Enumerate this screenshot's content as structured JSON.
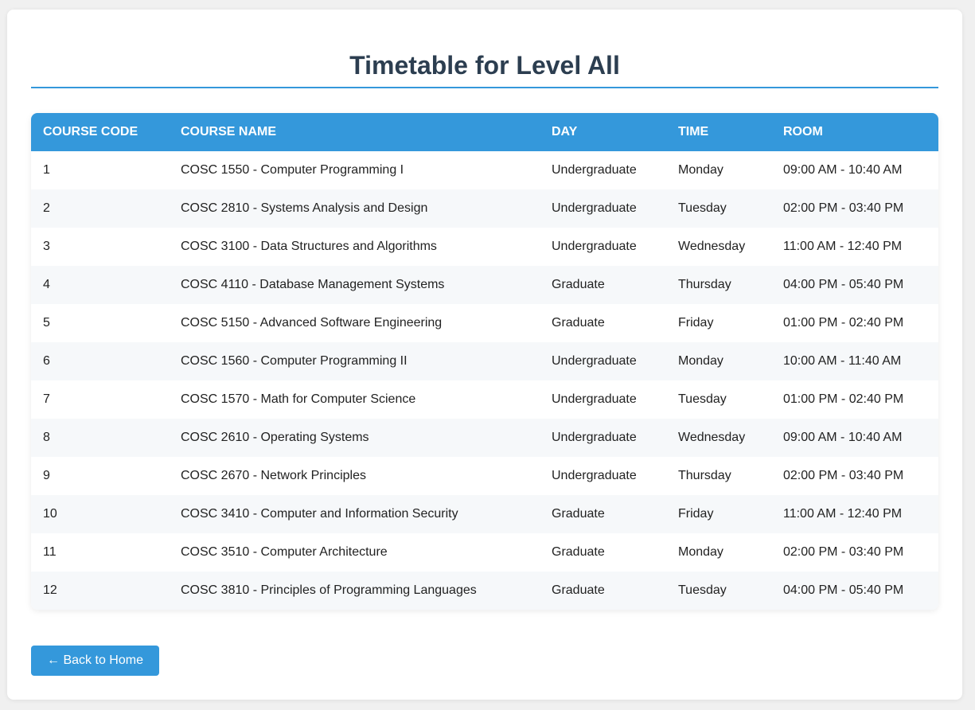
{
  "page": {
    "title": "Timetable for Level All"
  },
  "table": {
    "headers": [
      "Course Code",
      "Course Name",
      "Day",
      "Time",
      "Room"
    ],
    "rows": [
      [
        "1",
        "COSC 1550 - Computer Programming I",
        "Undergraduate",
        "Monday",
        "09:00 AM - 10:40 AM"
      ],
      [
        "2",
        "COSC 2810 - Systems Analysis and Design",
        "Undergraduate",
        "Tuesday",
        "02:00 PM - 03:40 PM"
      ],
      [
        "3",
        "COSC 3100 - Data Structures and Algorithms",
        "Undergraduate",
        "Wednesday",
        "11:00 AM - 12:40 PM"
      ],
      [
        "4",
        "COSC 4110 - Database Management Systems",
        "Graduate",
        "Thursday",
        "04:00 PM - 05:40 PM"
      ],
      [
        "5",
        "COSC 5150 - Advanced Software Engineering",
        "Graduate",
        "Friday",
        "01:00 PM - 02:40 PM"
      ],
      [
        "6",
        "COSC 1560 - Computer Programming II",
        "Undergraduate",
        "Monday",
        "10:00 AM - 11:40 AM"
      ],
      [
        "7",
        "COSC 1570 - Math for Computer Science",
        "Undergraduate",
        "Tuesday",
        "01:00 PM - 02:40 PM"
      ],
      [
        "8",
        "COSC 2610 - Operating Systems",
        "Undergraduate",
        "Wednesday",
        "09:00 AM - 10:40 AM"
      ],
      [
        "9",
        "COSC 2670 - Network Principles",
        "Undergraduate",
        "Thursday",
        "02:00 PM - 03:40 PM"
      ],
      [
        "10",
        "COSC 3410 - Computer and Information Security",
        "Graduate",
        "Friday",
        "11:00 AM - 12:40 PM"
      ],
      [
        "11",
        "COSC 3510 - Computer Architecture",
        "Graduate",
        "Monday",
        "02:00 PM - 03:40 PM"
      ],
      [
        "12",
        "COSC 3810 - Principles of Programming Languages",
        "Graduate",
        "Tuesday",
        "04:00 PM - 05:40 PM"
      ]
    ]
  },
  "back_button": {
    "label": "← Back to Home"
  },
  "colors": {
    "accent": "#3498db",
    "title_text": "#2c3e50",
    "row_alt": "#f6f8fa"
  }
}
